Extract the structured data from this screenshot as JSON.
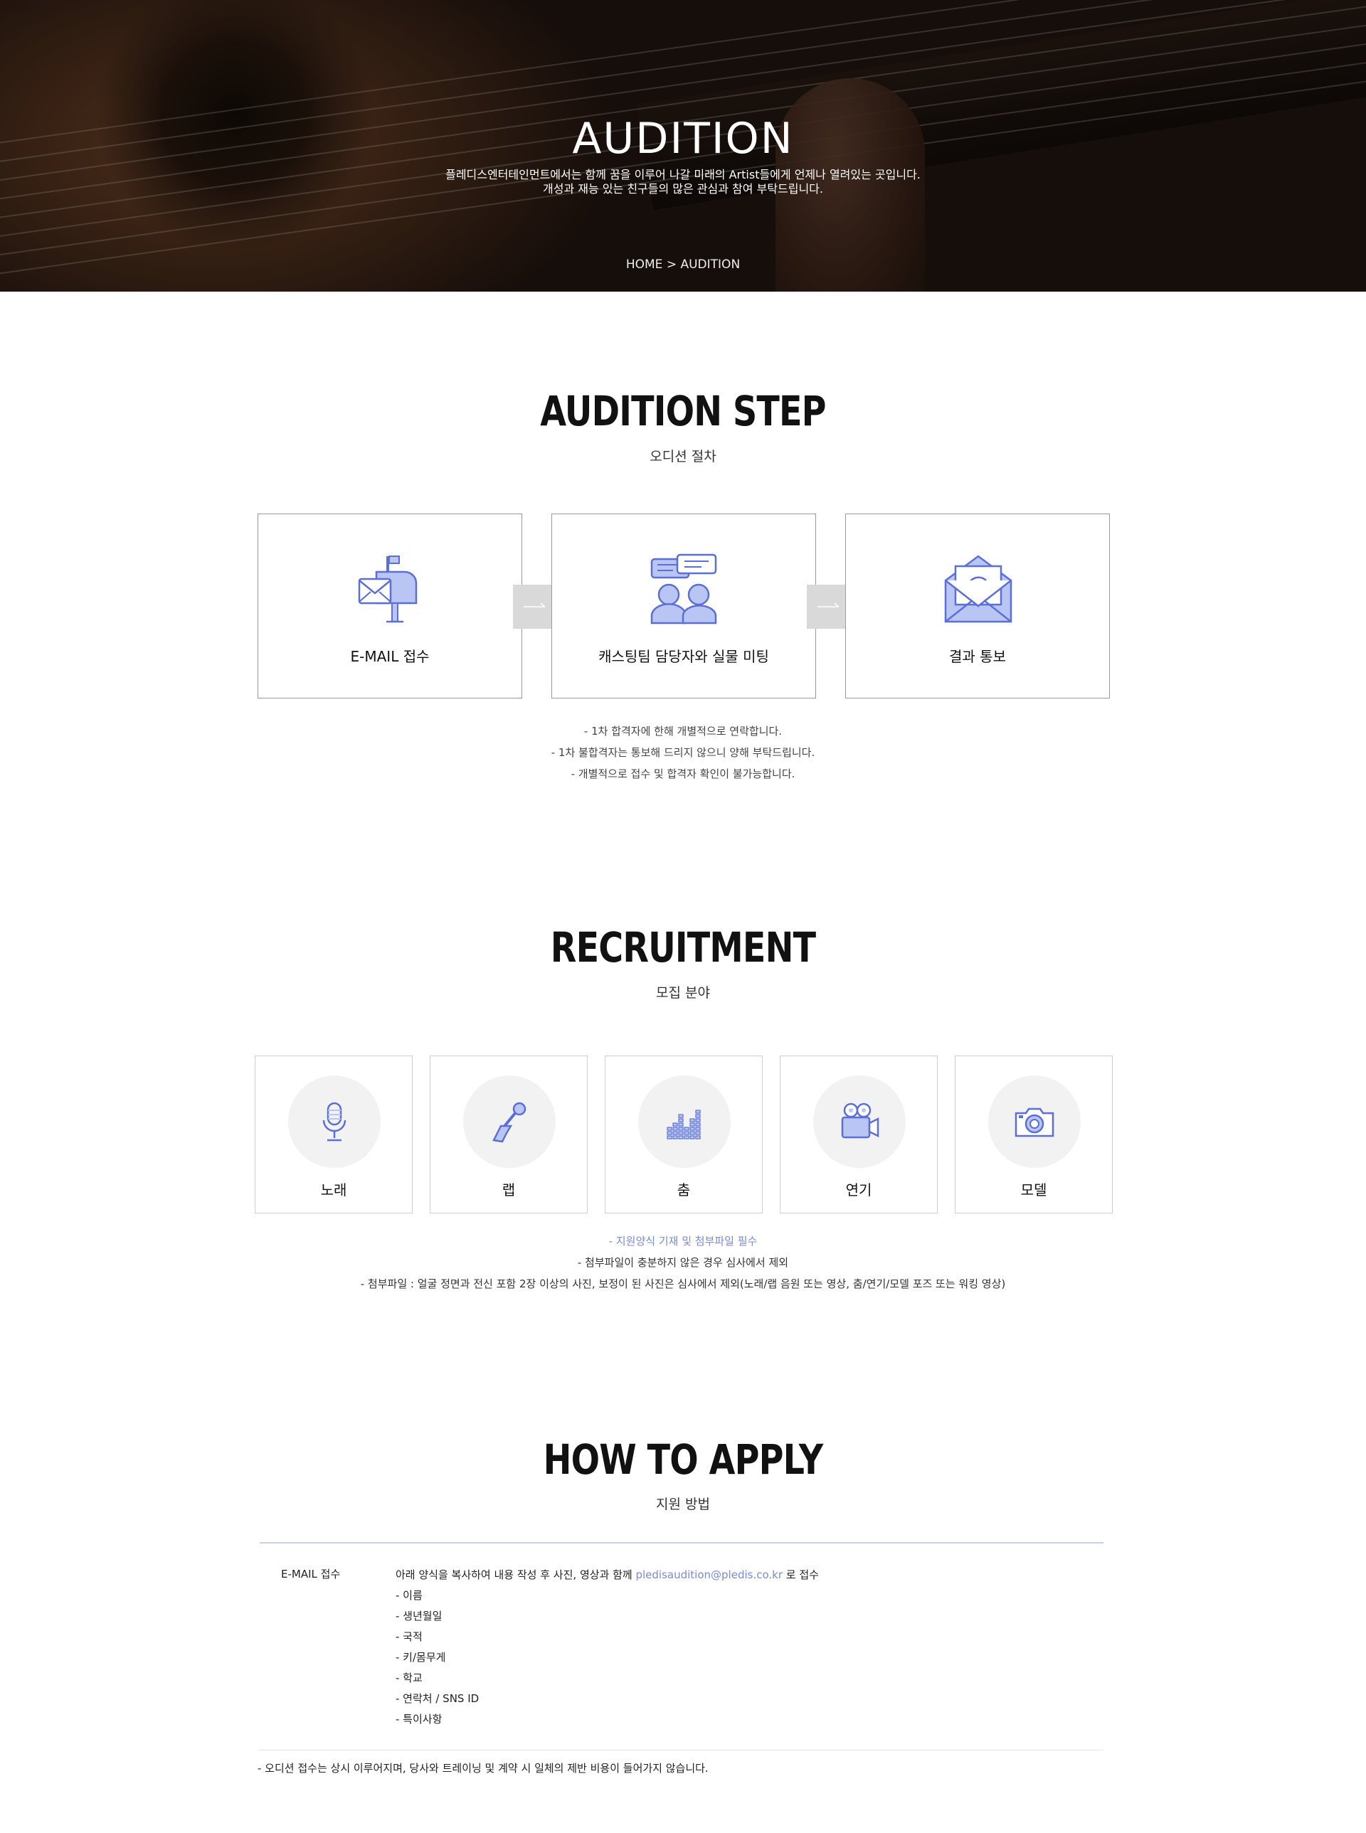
{
  "hero": {
    "title": "AUDITION",
    "desc_line1": "플레디스엔터테인먼트에서는 함께 꿈을 이루어 나갈 미래의 Artist들에게 언제나 열려있는 곳입니다.",
    "desc_line2": "개성과 재능 있는 친구들의 많은 관심과 참여 부탁드립니다.",
    "breadcrumb_home": "HOME",
    "breadcrumb_sep": ">",
    "breadcrumb_current": "AUDITION"
  },
  "steps": {
    "title": "AUDITION STEP",
    "subtitle": "오디션 절차",
    "items": [
      {
        "label": "E-MAIL 접수",
        "icon": "mailbox-icon"
      },
      {
        "label": "캐스팅팀 담당자와 실물 미팅",
        "icon": "meeting-icon"
      },
      {
        "label": "결과 통보",
        "icon": "envelope-at-icon"
      }
    ],
    "notes": [
      "- 1차 합격자에 한해 개별적으로 연락합니다.",
      "- 1차 불합격자는 통보해 드리지 않으니 양해 부탁드립니다.",
      "- 개별적으로 접수 및 합격자 확인이 불가능합니다."
    ]
  },
  "recruit": {
    "title": "RECRUITMENT",
    "subtitle": "모집 분야",
    "items": [
      {
        "label": "노래",
        "icon": "microphone-icon"
      },
      {
        "label": "랩",
        "icon": "hand-mic-icon"
      },
      {
        "label": "춤",
        "icon": "equalizer-icon"
      },
      {
        "label": "연기",
        "icon": "video-camera-icon"
      },
      {
        "label": "모델",
        "icon": "camera-icon"
      }
    ],
    "note_highlight": "- 지원양식 기재 및 첨부파일 필수",
    "note2": "- 첨부파일이 충분하지 않은 경우 심사에서 제외",
    "note3": "- 첨부파일 : 얼굴 정면과 전신 포함 2장 이상의 사진, 보정이 된 사진은 심사에서 제외(노래/랩 음원 또는 영상, 춤/연기/모델 포즈 또는 워킹 영상)"
  },
  "apply": {
    "title": "HOW TO APPLY",
    "subtitle": "지원 방법",
    "method_label": "E-MAIL 접수",
    "intro_before": "아래 양식을 복사하여 내용 작성 후 사진, 영상과 함께 ",
    "email": "pledisaudition@pledis.co.kr",
    "intro_after": " 로 접수",
    "fields": [
      "- 이름",
      "- 생년월일",
      "- 국적",
      "- 키/몸무게",
      "- 학교",
      "- 연락처 / SNS ID",
      "- 특이사항"
    ],
    "footnote": "- 오디션 접수는 상시 이루어지며, 당사와 트레이닝 및 계약 시 일체의 제반 비용이 들어가지 않습니다."
  },
  "colors": {
    "accent": "#7b8ad8",
    "icon_stroke": "#5b6fd6",
    "icon_fill": "#b9c6f3"
  }
}
